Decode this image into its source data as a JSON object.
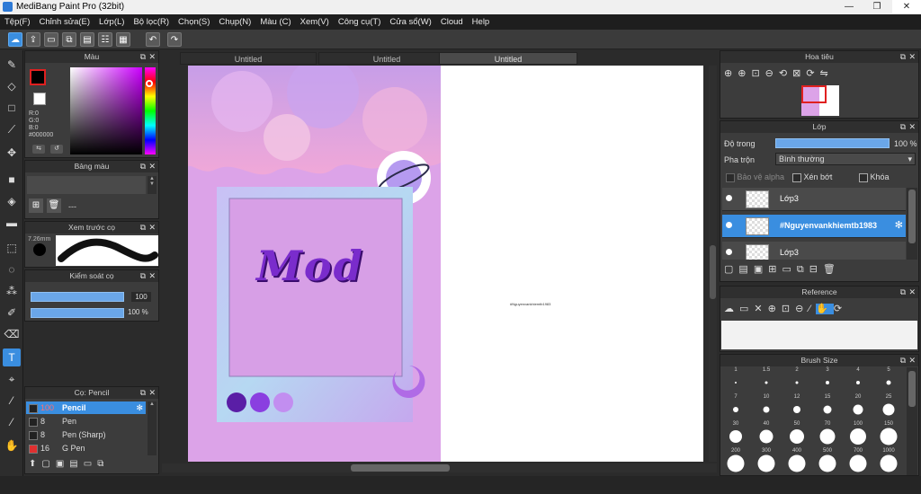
{
  "window": {
    "title": "MediBang Paint Pro (32bit)",
    "controls": [
      "—",
      "❐",
      "✕"
    ]
  },
  "menu": [
    "Tệp(F)",
    "Chỉnh sửa(E)",
    "Lớp(L)",
    "Bộ lọc(R)",
    "Chọn(S)",
    "Chụp(N)",
    "Màu (C)",
    "Xem(V)",
    "Công cụ(T)",
    "Cửa sổ(W)",
    "Cloud",
    "Help"
  ],
  "color_panel": {
    "title": "Màu",
    "r": "R:0",
    "g": "G:0",
    "b": "B:0",
    "hex": "#000000",
    "foreground": "#000000",
    "background": "#ffffff"
  },
  "palette_panel": {
    "title": "Bảng màu",
    "status": "---"
  },
  "brush_preview": {
    "title": "Xem trước cọ",
    "size": "7.26mm"
  },
  "brush_control": {
    "title": "Kiểm soát cọ",
    "size_value": "100",
    "opacity_value": "100 %"
  },
  "brush_list": {
    "title": "Cọ: Pencil",
    "items": [
      {
        "size": "100",
        "name": "Pencil",
        "color": "#222222",
        "selected": true
      },
      {
        "size": "8",
        "name": "Pen",
        "color": "#222222",
        "selected": false
      },
      {
        "size": "8",
        "name": "Pen (Sharp)",
        "color": "#222222",
        "selected": false
      },
      {
        "size": "16",
        "name": "G Pen",
        "color": "#e03030",
        "selected": false
      }
    ]
  },
  "tabs": [
    "Untitled",
    "Untitled",
    "Untitled"
  ],
  "active_tab": 2,
  "canvas": {
    "text": "Mod",
    "tiny_text": "#Nguyenvankhiemtb1983"
  },
  "navigator": {
    "title": "Hoa tiêu"
  },
  "layer_panel": {
    "title": "Lớp",
    "opacity_label": "Độ trong",
    "opacity_value": "100 %",
    "opacity": 1.0,
    "blend_label": "Pha trộn",
    "blend_value": "Bình thường",
    "protect_alpha": "Bảo vệ alpha",
    "clipping": "Xén bớt",
    "lock": "Khóa",
    "layers": [
      {
        "name": "Lớp3",
        "selected": false
      },
      {
        "name": "#Nguyenvankhiemtb1983",
        "selected": true
      },
      {
        "name": "Lớp3",
        "selected": false
      }
    ]
  },
  "reference": {
    "title": "Reference"
  },
  "brush_size": {
    "title": "Brush Size",
    "rows": [
      [
        "1",
        "1.5",
        "2",
        "3",
        "4",
        "5"
      ],
      [
        "7",
        "10",
        "12",
        "15",
        "20",
        "25"
      ],
      [
        "30",
        "40",
        "50",
        "70",
        "100",
        "150"
      ],
      [
        "200",
        "300",
        "400",
        "500",
        "700",
        "1000"
      ]
    ]
  }
}
